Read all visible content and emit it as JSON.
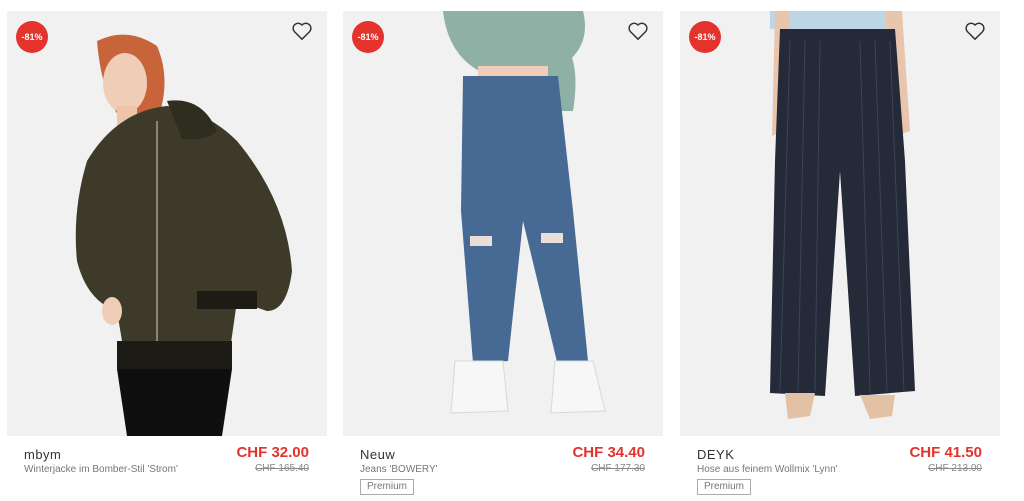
{
  "products": [
    {
      "discount": "-81%",
      "brand": "mbym",
      "description": "Winterjacke im Bomber-Stil 'Strom'",
      "price": "CHF 32.00",
      "old_price": "CHF 165.40",
      "tag": ""
    },
    {
      "discount": "-81%",
      "brand": "Neuw",
      "description": "Jeans 'BOWERY'",
      "price": "CHF 34.40",
      "old_price": "CHF 177.30",
      "tag": "Premium"
    },
    {
      "discount": "-81%",
      "brand": "DEYK",
      "description": "Hose aus feinem Wollmix 'Lynn'",
      "price": "CHF 41.50",
      "old_price": "CHF 213.00",
      "tag": "Premium"
    }
  ],
  "colors": {
    "accent": "#e4332d",
    "image_bg": "#f1f1f1"
  },
  "icons": [
    "heart-icon"
  ]
}
